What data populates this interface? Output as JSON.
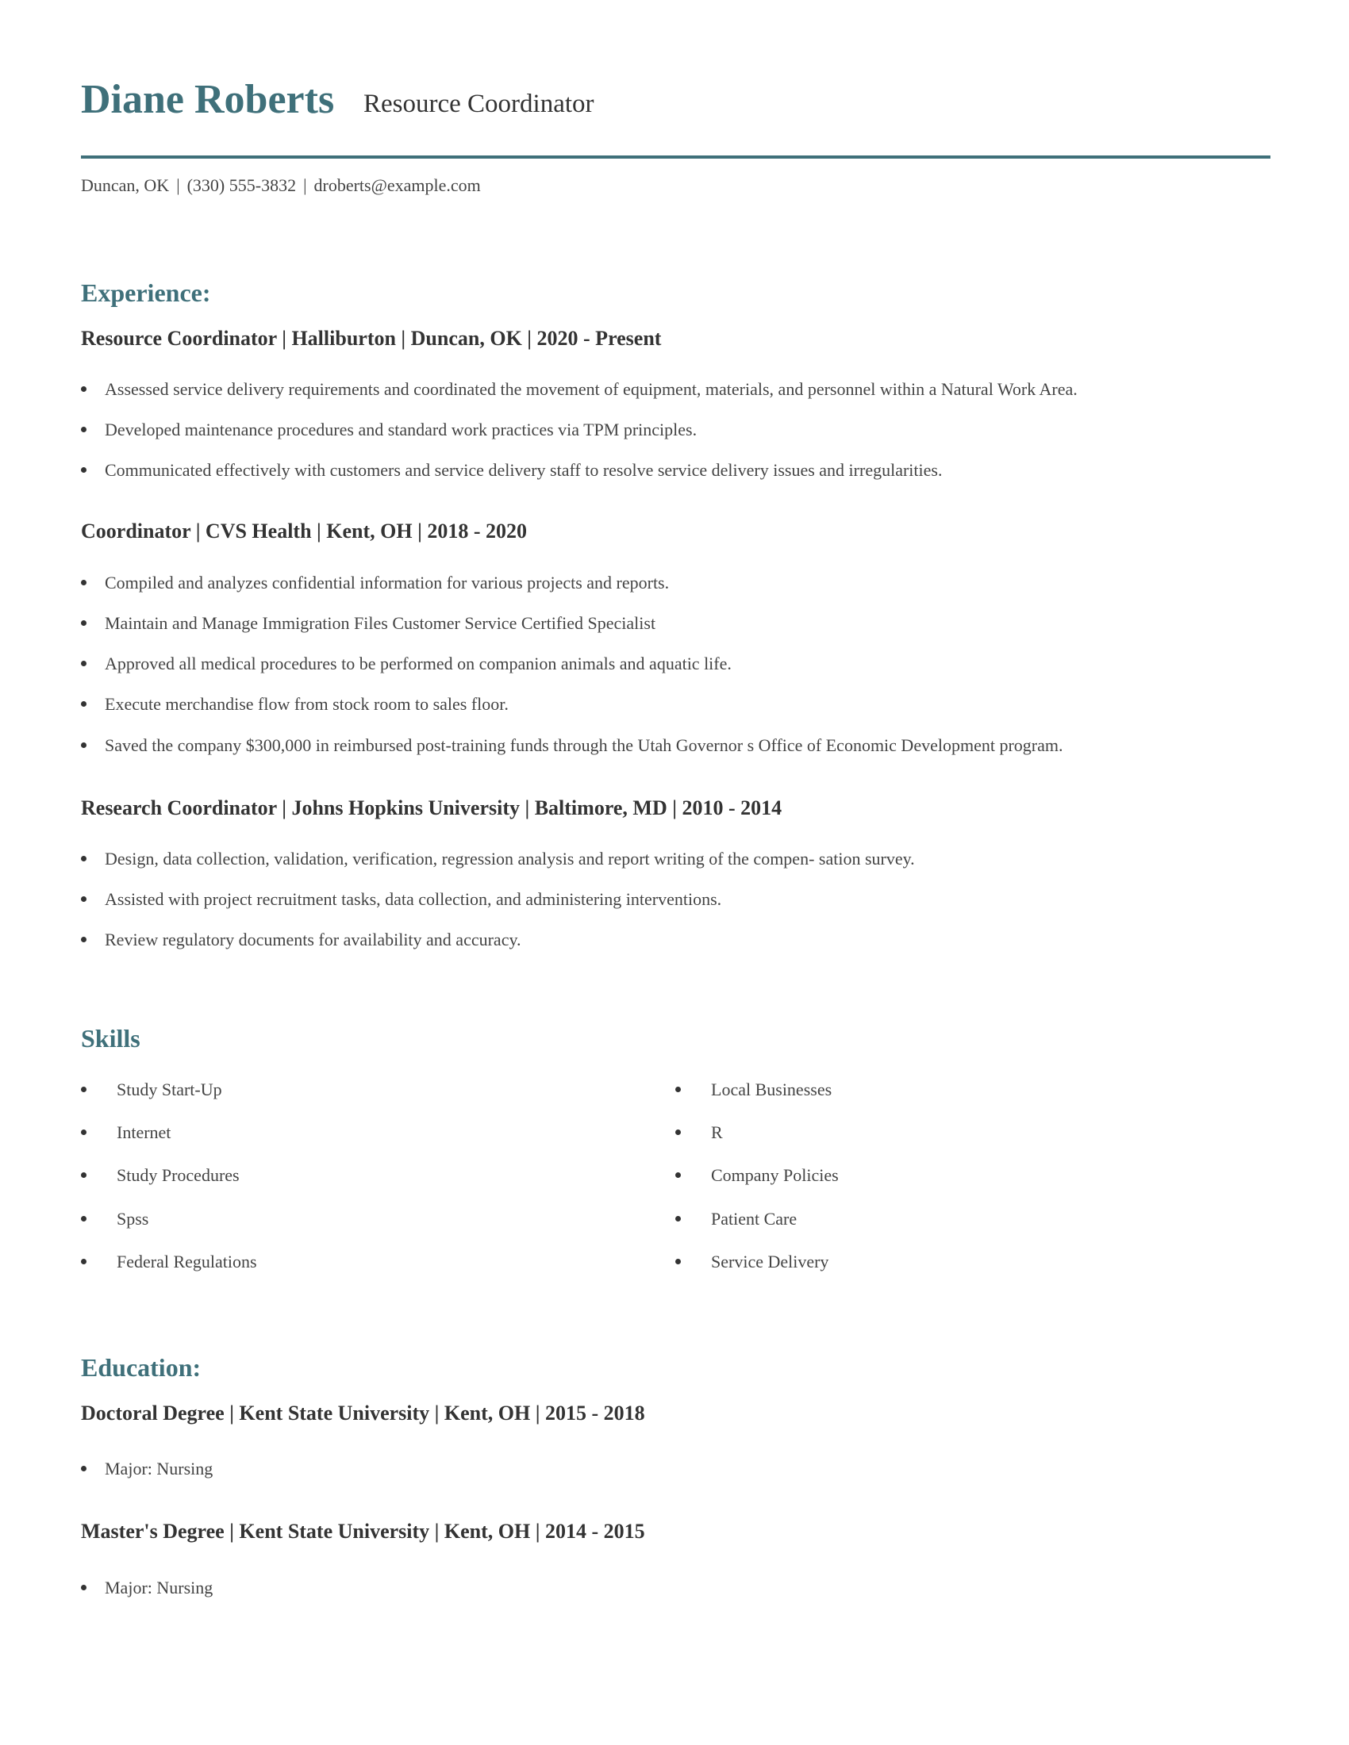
{
  "header": {
    "name": "Diane Roberts",
    "title": "Resource Coordinator",
    "accent_color": "#3f707a",
    "contact": {
      "location": "Duncan, OK",
      "phone": "(330) 555-3832",
      "email": "droberts@example.com",
      "separator": "|"
    }
  },
  "experience": {
    "heading": "Experience:",
    "jobs": [
      {
        "title_line": "Resource Coordinator | Halliburton | Duncan, OK |  2020 - Present",
        "bullets": [
          "Assessed service delivery requirements and coordinated the movement of equipment, materials, and personnel within a Natural Work Area.",
          "Developed maintenance procedures and standard work practices via TPM principles.",
          "Communicated effectively with customers and service delivery staff to resolve service delivery issues and irregularities."
        ]
      },
      {
        "title_line": "Coordinator | CVS Health | Kent, OH |  2018 - 2020",
        "bullets": [
          "Compiled and analyzes confidential information for various projects and reports.",
          "Maintain and Manage Immigration Files Customer Service Certified Specialist",
          "Approved all medical procedures to be performed on companion animals and aquatic life.",
          "Execute merchandise flow from stock room to sales floor.",
          "Saved the company $300,000 in reimbursed post-training funds through the Utah Governor s Office of Economic Development program."
        ]
      },
      {
        "title_line": "Research Coordinator | Johns Hopkins University | Baltimore, MD |  2010 - 2014",
        "bullets": [
          "Design, data collection, validation, verification, regression analysis and report writing of the compen- sation survey.",
          "Assisted with project recruitment tasks, data collection, and administering interventions.",
          "Review regulatory documents for availability and accuracy."
        ]
      }
    ]
  },
  "skills": {
    "heading": "Skills",
    "left": [
      "Study Start-Up",
      "Internet",
      "Study Procedures",
      "Spss",
      "Federal Regulations"
    ],
    "right": [
      "Local Businesses",
      "R",
      "Company Policies",
      "Patient Care",
      "Service Delivery"
    ]
  },
  "education": {
    "heading": "Education:",
    "degrees": [
      {
        "title_line": "Doctoral Degree | Kent State University | Kent, OH |  2015 - 2018",
        "bullets": [
          "Major: Nursing"
        ]
      },
      {
        "title_line": "Master's Degree | Kent State University | Kent, OH |  2014 - 2015",
        "bullets": [
          "Major: Nursing"
        ]
      }
    ]
  }
}
